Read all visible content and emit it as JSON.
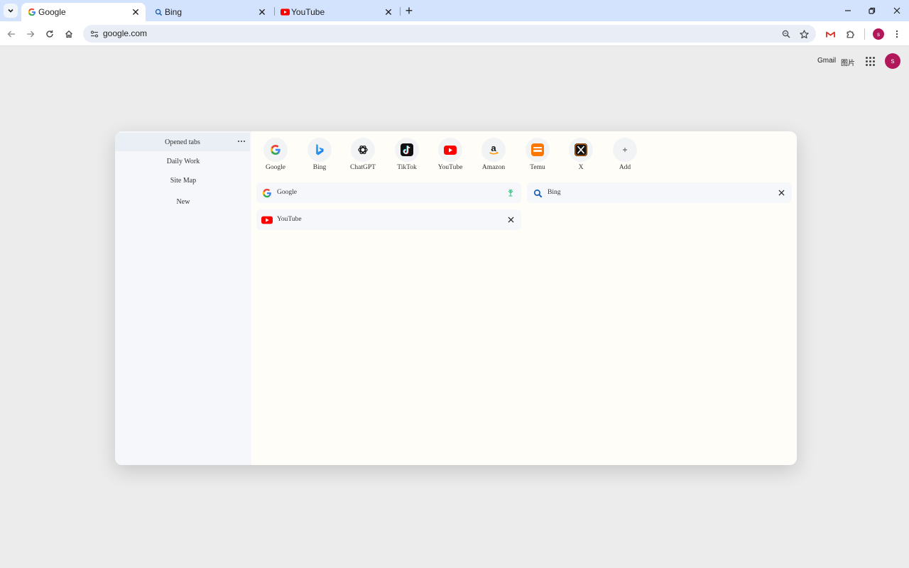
{
  "browser": {
    "tabs": [
      {
        "title": "Google",
        "favicon": "google-favicon",
        "active": true
      },
      {
        "title": "Bing",
        "favicon": "search-favicon",
        "active": false
      },
      {
        "title": "YouTube",
        "favicon": "youtube-favicon",
        "active": false
      }
    ],
    "address": "google.com"
  },
  "google_header": {
    "gmail": "Gmail",
    "images": "图片",
    "profile_initial": "s"
  },
  "panel": {
    "sidebar": [
      {
        "label": "Opened tabs",
        "selected": true
      },
      {
        "label": "Daily Work",
        "selected": false
      },
      {
        "label": "Site Map",
        "selected": false
      },
      {
        "label": "New",
        "selected": false
      }
    ],
    "shortcuts": [
      {
        "label": "Google",
        "icon": "google-icon"
      },
      {
        "label": "Bing",
        "icon": "bing-icon"
      },
      {
        "label": "ChatGPT",
        "icon": "chatgpt-icon"
      },
      {
        "label": "TikTok",
        "icon": "tiktok-icon"
      },
      {
        "label": "YouTube",
        "icon": "youtube-icon"
      },
      {
        "label": "Amazon",
        "icon": "amazon-icon"
      },
      {
        "label": "Temu",
        "icon": "temu-icon"
      },
      {
        "label": "X",
        "icon": "x-icon"
      },
      {
        "label": "Add",
        "icon": "plus-icon"
      }
    ],
    "opened_tabs": [
      {
        "title": "Google",
        "favicon": "google-icon",
        "action": "plant-icon"
      },
      {
        "title": "Bing",
        "favicon": "search-icon",
        "action": "close-icon"
      },
      {
        "title": "YouTube",
        "favicon": "youtube-icon",
        "action": "close-icon"
      }
    ]
  }
}
